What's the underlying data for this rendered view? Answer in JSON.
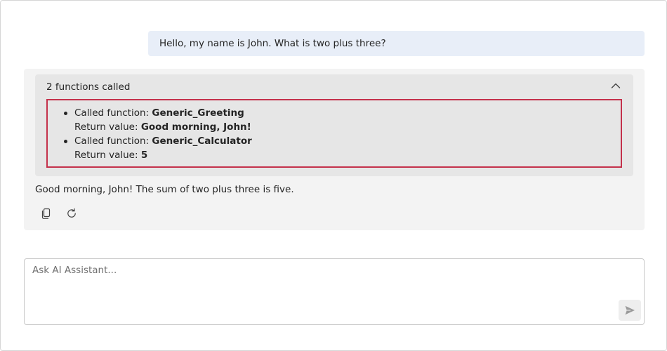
{
  "conversation": {
    "user_message": "Hello, my name is John. What is two plus three?",
    "assistant": {
      "functions_panel": {
        "header": "2 functions called",
        "expanded": true,
        "calls": [
          {
            "called_label": "Called function: ",
            "name": "Generic_Greeting",
            "return_label": "Return value: ",
            "return_value": "Good morning, John!"
          },
          {
            "called_label": "Called function: ",
            "name": "Generic_Calculator",
            "return_label": "Return value: ",
            "return_value": "5"
          }
        ]
      },
      "answer": "Good morning, John! The sum of two plus three is five.",
      "actions": {
        "copy_icon": "copy-icon",
        "retry_icon": "refresh-icon"
      }
    }
  },
  "composer": {
    "placeholder": "Ask AI Assistant...",
    "value": "",
    "send_icon": "send-icon"
  },
  "colors": {
    "user_bubble": "#e8eef8",
    "assistant_card": "#f3f3f3",
    "function_panel": "#e6e6e6",
    "highlight_border": "#c4314b"
  }
}
